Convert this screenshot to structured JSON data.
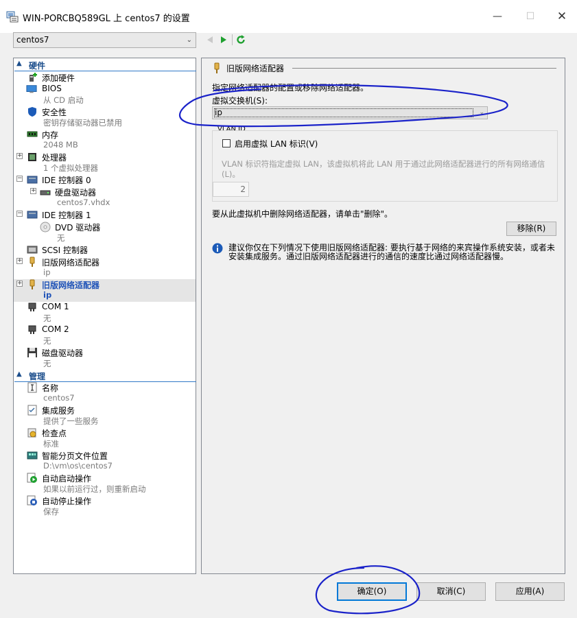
{
  "window": {
    "title": "WIN-PORCBQ589GL 上 centos7 的设置",
    "controls": {
      "minimize": "—",
      "maximize": "☐",
      "close": "✕"
    }
  },
  "vm_selector": {
    "value": "centos7"
  },
  "tree": {
    "sections": [
      {
        "label": "硬件"
      },
      {
        "label": "管理"
      }
    ],
    "items": [
      {
        "label": "添加硬件",
        "sub": "",
        "icon": "add-hardware-icon"
      },
      {
        "label": "BIOS",
        "sub": "从 CD 启动",
        "icon": "bios-icon"
      },
      {
        "label": "安全性",
        "sub": "密钥存储驱动器已禁用",
        "icon": "shield-icon"
      },
      {
        "label": "内存",
        "sub": "2048 MB",
        "icon": "memory-icon"
      },
      {
        "label": "处理器",
        "sub": "1 个虚拟处理器",
        "icon": "processor-icon"
      },
      {
        "label": "IDE 控制器 0",
        "sub": "",
        "icon": "ide-controller-icon"
      },
      {
        "label": "硬盘驱动器",
        "sub": "centos7.vhdx",
        "icon": "hard-drive-icon"
      },
      {
        "label": "IDE 控制器 1",
        "sub": "",
        "icon": "ide-controller-icon"
      },
      {
        "label": "DVD 驱动器",
        "sub": "无",
        "icon": "dvd-icon"
      },
      {
        "label": "SCSI 控制器",
        "sub": "",
        "icon": "scsi-controller-icon"
      },
      {
        "label": "旧版网络适配器",
        "sub": "ip",
        "icon": "network-adapter-icon"
      },
      {
        "label": "旧版网络适配器",
        "sub": "ip",
        "icon": "network-adapter-icon"
      },
      {
        "label": "COM 1",
        "sub": "无",
        "icon": "com-port-icon"
      },
      {
        "label": "COM 2",
        "sub": "无",
        "icon": "com-port-icon"
      },
      {
        "label": "磁盘驱动器",
        "sub": "无",
        "icon": "floppy-icon"
      },
      {
        "label": "名称",
        "sub": "centos7",
        "icon": "name-icon"
      },
      {
        "label": "集成服务",
        "sub": "提供了一些服务",
        "icon": "integration-services-icon"
      },
      {
        "label": "检查点",
        "sub": "标准",
        "icon": "checkpoint-icon"
      },
      {
        "label": "智能分页文件位置",
        "sub": "D:\\vm\\os\\centos7",
        "icon": "smart-paging-icon"
      },
      {
        "label": "自动启动操作",
        "sub": "如果以前运行过，则重新启动",
        "icon": "auto-start-icon"
      },
      {
        "label": "自动停止操作",
        "sub": "保存",
        "icon": "auto-stop-icon"
      }
    ]
  },
  "panel": {
    "heading": "旧版网络适配器",
    "description": "指定网络适配器的配置或移除网络适配器。",
    "switch_label": "虚拟交换机(S):",
    "switch_value": "ip",
    "vlan_group_label": "VLAN ID",
    "vlan_checkbox_label": "启用虚拟 LAN 标识(V)",
    "vlan_description": "VLAN 标识符指定虚拟 LAN，该虚拟机将此 LAN 用于通过此网络适配器进行的所有网络通信(L)。",
    "vlan_value": "2",
    "remove_text": "要从此虚拟机中删除网络适配器，请单击\"删除\"。",
    "remove_button": "移除(R)",
    "info_text": "建议你仅在下列情况下使用旧版网络适配器: 要执行基于网络的来宾操作系统安装，或者未安装集成服务。通过旧版网络适配器进行的通信的速度比通过网络适配器慢。"
  },
  "buttons": {
    "ok": "确定(O)",
    "cancel": "取消(C)",
    "apply": "应用(A)"
  },
  "colors": {
    "accent": "#0078d7",
    "selected_text": "#1f53b8",
    "annotation": "#1a22c9"
  }
}
